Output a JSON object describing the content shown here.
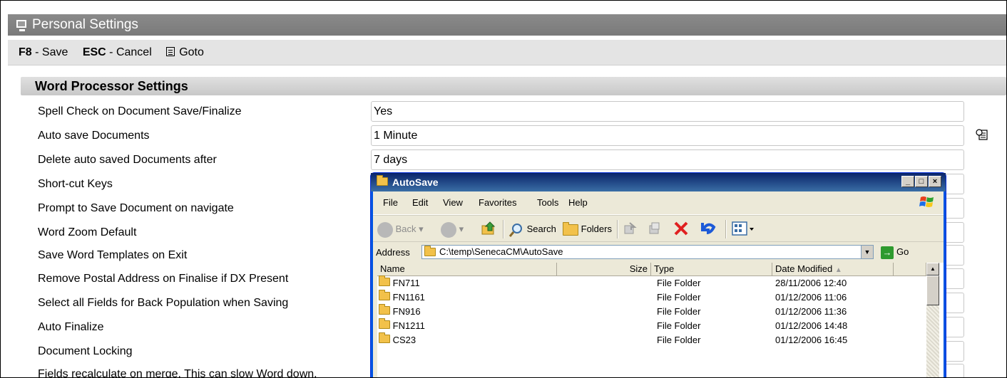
{
  "window": {
    "title": "Personal Settings"
  },
  "toolbar": {
    "save_key": "F8",
    "save_label": " - Save",
    "cancel_key": "ESC",
    "cancel_label": " - Cancel",
    "goto_label": "Goto"
  },
  "section": {
    "title": "Word Processor Settings"
  },
  "settings": [
    {
      "label": "Spell Check on Document Save/Finalize",
      "value": "Yes"
    },
    {
      "label": "Auto save Documents",
      "value": "1 Minute"
    },
    {
      "label": "Delete auto saved Documents after",
      "value": "7 days"
    },
    {
      "label": "Short-cut Keys",
      "value": ""
    },
    {
      "label": "Prompt to Save Document on navigate",
      "value": ""
    },
    {
      "label": "Word Zoom Default",
      "value": ""
    },
    {
      "label": "Save Word Templates on Exit",
      "value": ""
    },
    {
      "label": "Remove Postal Address on Finalise if DX Present",
      "value": ""
    },
    {
      "label": "Select all Fields for Back Population when Saving",
      "value": ""
    },
    {
      "label": "Auto Finalize",
      "value": ""
    },
    {
      "label": "Document Locking",
      "value": ""
    },
    {
      "label": "Fields recalculate on merge. This can slow Word down.",
      "value": ""
    }
  ],
  "explorer": {
    "title": "AutoSave",
    "menu": [
      "File",
      "Edit",
      "View",
      "Favorites",
      "Tools",
      "Help"
    ],
    "toolbar": {
      "back": "Back",
      "search": "Search",
      "folders": "Folders"
    },
    "address_label": "Address",
    "address": "C:\\temp\\SenecaCM\\AutoSave",
    "go": "Go",
    "columns": [
      "Name",
      "Size",
      "Type",
      "Date Modified"
    ],
    "rows": [
      {
        "name": "FN711",
        "size": "",
        "type": "File Folder",
        "date": "28/11/2006 12:40"
      },
      {
        "name": "FN1161",
        "size": "",
        "type": "File Folder",
        "date": "01/12/2006 11:06"
      },
      {
        "name": "FN916",
        "size": "",
        "type": "File Folder",
        "date": "01/12/2006 11:36"
      },
      {
        "name": "FN1211",
        "size": "",
        "type": "File Folder",
        "date": "01/12/2006 14:48"
      },
      {
        "name": "CS23",
        "size": "",
        "type": "File Folder",
        "date": "01/12/2006 16:45"
      }
    ]
  },
  "colors": {
    "titlebar": "#808080",
    "toolbar": "#e4e4e4",
    "xp_blue": "#0054e3",
    "xp_face": "#ece9d8"
  }
}
